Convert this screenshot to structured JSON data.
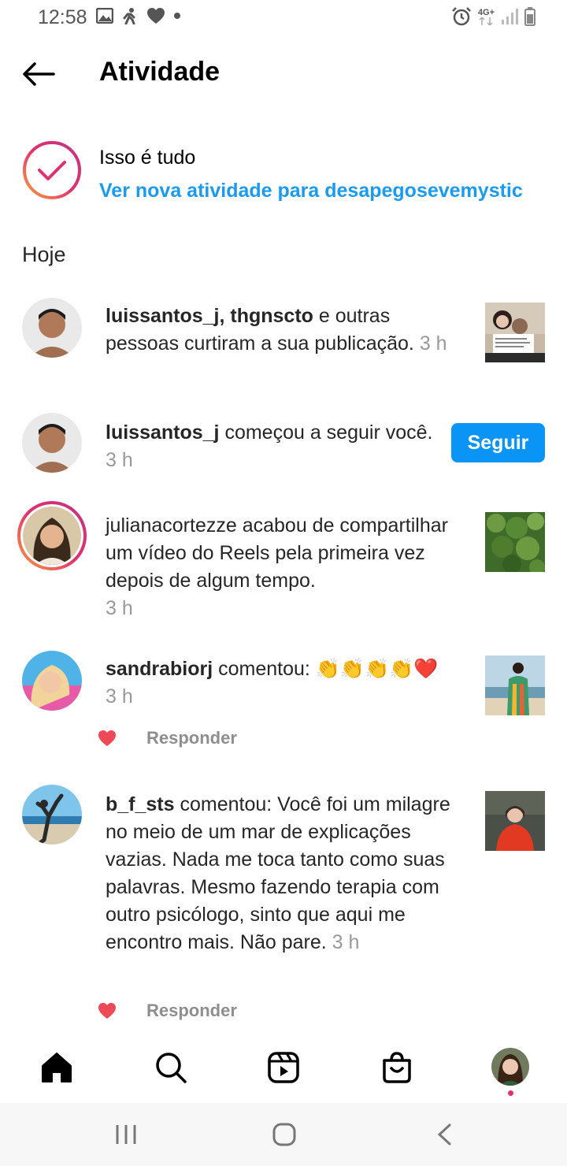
{
  "status_bar": {
    "time": "12:58",
    "network": "4G+",
    "left_icons": [
      "image-icon",
      "fitness-icon",
      "heart-icon",
      "dot-icon"
    ],
    "right_icons": [
      "alarm-icon",
      "signal-icon",
      "battery-icon"
    ]
  },
  "header": {
    "title": "Atividade",
    "back_icon": "back-arrow-icon"
  },
  "all_caught_up": {
    "title": "Isso é tudo",
    "link": "Ver nova atividade para desapegosevemystic"
  },
  "section": {
    "today": "Hoje"
  },
  "notifications": [
    {
      "users": "luissantos_j, thgnscto",
      "text": " e outras pessoas curtiram a sua publicação. ",
      "time": "3 h"
    },
    {
      "users": "luissantos_j",
      "text": " começou a seguir você. ",
      "time": "3 h",
      "button": "Seguir"
    },
    {
      "users": "",
      "text": "julianacortezze acabou de compartilhar um vídeo do Reels pela primeira vez depois de algum tempo.",
      "time": "3 h"
    },
    {
      "users": "sandrabiorj",
      "text": " comentou: 👏👏👏👏❤️",
      "time": "3 h",
      "reply": "Responder"
    },
    {
      "users": "b_f_sts",
      "text": " comentou: Você foi um milagre no meio de um mar de explicações vazias. Nada me toca tanto como suas palavras. Mesmo fazendo terapia com outro psicólogo, sinto que aqui me encontro mais. Não pare. ",
      "time": "3 h",
      "reply": "Responder"
    }
  ],
  "bottom_nav": [
    "home-icon",
    "search-icon",
    "reels-icon",
    "shop-icon",
    "profile-avatar"
  ],
  "system_nav": [
    "recents-icon",
    "home-circle-icon",
    "back-chevron-icon"
  ],
  "colors": {
    "link_blue": "#1a9bf0",
    "follow_blue": "#0a95f6",
    "like_red": "#ed4956",
    "ring_start": "#f9a03f",
    "ring_end": "#c13584"
  }
}
